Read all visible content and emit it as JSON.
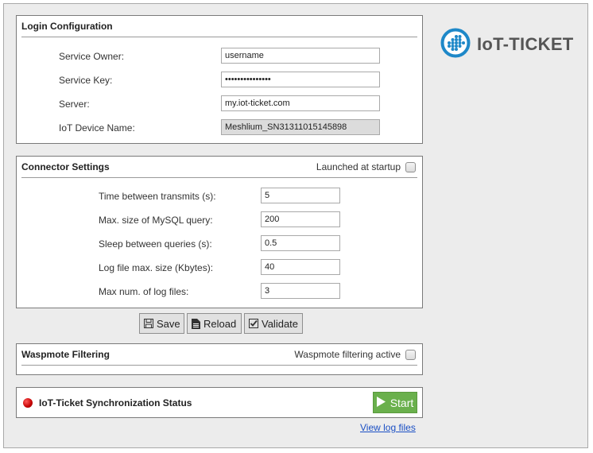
{
  "logo": {
    "text": "IoT-TICKET",
    "icon": "iot-ticket-logo-icon",
    "brand_color": "#1e88c8"
  },
  "login": {
    "title": "Login Configuration",
    "fields": [
      {
        "label": "Service Owner:",
        "value": "username",
        "disabled": false
      },
      {
        "label": "Service Key:",
        "value": "•••••••••••••••",
        "disabled": false
      },
      {
        "label": "Server:",
        "value": "my.iot-ticket.com",
        "disabled": false
      },
      {
        "label": "IoT Device Name:",
        "value": "Meshlium_SN31311015145898",
        "disabled": true
      }
    ]
  },
  "connector": {
    "title": "Connector Settings",
    "checkbox_label": "Launched at startup",
    "checked": false,
    "fields": [
      {
        "label": "Time between transmits (s):",
        "value": "5"
      },
      {
        "label": "Max. size of MySQL query:",
        "value": "200"
      },
      {
        "label": "Sleep between queries (s):",
        "value": "0.5"
      },
      {
        "label": "Log file max. size (Kbytes):",
        "value": "40"
      },
      {
        "label": "Max num. of log files:",
        "value": "3"
      }
    ]
  },
  "toolbar": {
    "save_label": "Save",
    "reload_label": "Reload",
    "validate_label": "Validate"
  },
  "filtering": {
    "title": "Waspmote Filtering",
    "checkbox_label": "Waspmote filtering active",
    "checked": false
  },
  "sync": {
    "title": "IoT-Ticket Synchronization Status",
    "status_color": "#c40000",
    "start_label": "Start",
    "start_color": "#6ab04c"
  },
  "links": {
    "view_logs": "View log files"
  }
}
